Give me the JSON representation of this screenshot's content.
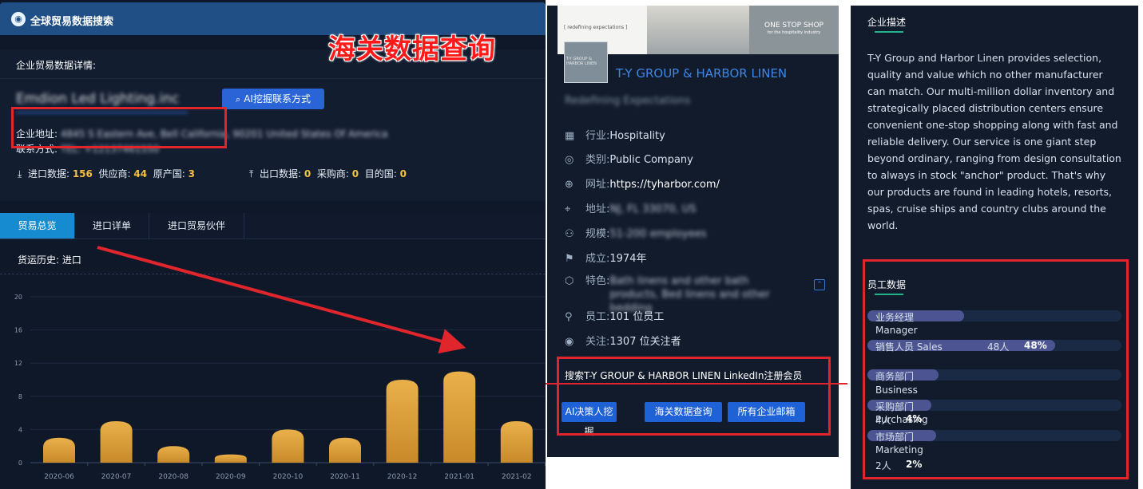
{
  "left": {
    "title": "全球贸易数据搜索",
    "section_header": "企业贸易数据详情:",
    "company_name": "Emdion Led Lighting.inc",
    "ai_button": "AI挖掘联系方式",
    "overlay_text": "海关数据查询",
    "address_label": "企业地址:",
    "address_value": "4845 S Eastern Ave, Bell California, 90201 United States Of America",
    "contact_label": "联系方式:",
    "contact_value": "TEL: +12137461550",
    "import_label": "进口数据:",
    "import_count": "156",
    "supplier_label": "供应商:",
    "supplier_count": "44",
    "origin_label": "原产国:",
    "origin_count": "3",
    "export_label": "出口数据:",
    "export_count": "0",
    "buyer_label": "采购商:",
    "buyer_count": "0",
    "dest_label": "目的国:",
    "dest_count": "0",
    "tabs": [
      "贸易总览",
      "进口详单",
      "进口贸易伙伴"
    ],
    "history_label": "货运历史: 进口"
  },
  "chart_data": {
    "type": "bar",
    "categories": [
      "2020-06",
      "2020-07",
      "2020-08",
      "2020-09",
      "2020-10",
      "2020-11",
      "2020-12",
      "2021-01",
      "2021-02"
    ],
    "values": [
      3,
      5,
      2,
      1,
      4,
      3,
      10,
      11,
      5
    ],
    "ylim": [
      0,
      20
    ],
    "yticks": [
      "0",
      "4",
      "8",
      "12",
      "16",
      "20"
    ],
    "grid": true,
    "bar_color": "#e9b04a"
  },
  "middle": {
    "banner_left": "[ redefining expectations ]",
    "banner_right": "ONE STOP SHOP",
    "banner_right_sub": "for the hospitality industry",
    "logo_text": "T-Y GROUP & HARBOR LINEN",
    "company": "T-Y GROUP & HARBOR LINEN",
    "tagline": "Redefining Expectations",
    "rows": [
      {
        "icon": "building-icon",
        "glyph": "▦",
        "label": "行业:",
        "value": "Hospitality"
      },
      {
        "icon": "target-icon",
        "glyph": "◎",
        "label": "类别:",
        "value": "Public Company"
      },
      {
        "icon": "globe-icon",
        "glyph": "⊕",
        "label": "网址:",
        "value": "https://tyharbor.com/"
      },
      {
        "icon": "location-icon",
        "glyph": "⌖",
        "label": "地址:",
        "value": "NJ, FL 33070, US"
      },
      {
        "icon": "people-icon",
        "glyph": "⚇",
        "label": "规模:",
        "value": "51-200 employees"
      },
      {
        "icon": "flag-icon",
        "glyph": "⚑",
        "label": "成立:",
        "value": "1974年"
      },
      {
        "icon": "cube-icon",
        "glyph": "⬡",
        "label": "特色:",
        "value": "Bath linens and other bath products, Bed linens and other bedding"
      },
      {
        "icon": "user-check-icon",
        "glyph": "⚲",
        "label": "员工:",
        "value": "101 位员工"
      },
      {
        "icon": "eye-icon",
        "glyph": "◉",
        "label": "关注:",
        "value": "1307 位关注者"
      }
    ],
    "search_text": "搜索T-Y GROUP & HARBOR LINEN LinkedIn注册会员",
    "buttons": [
      "AI决策人挖掘",
      "海关数据查询",
      "所有企业邮箱"
    ]
  },
  "right": {
    "desc_title": "企业描述",
    "description": "T-Y Group and Harbor Linen provides selection, quality and value which no other manufacturer can match. Our multi-million dollar inventory and strategically placed distribution centers ensure convenient one-stop shopping along with fast and reliable delivery. Our service is one giant step beyond ordinary, ranging from design consultation to always in stock \"anchor\" product. That's why our products are found in leading hotels, resorts, spas, cruise ships and country clubs around the world.",
    "emp_title": "员工数据",
    "employees": [
      {
        "dept": "业务经理",
        "role": "Manager",
        "fill": 0.38
      },
      {
        "dept": "销售人员 Sales",
        "count": "48人",
        "pct": "48%",
        "fill": 0.74
      },
      {
        "dept": "商务部门",
        "role": "Business",
        "fill": 0.28
      },
      {
        "dept": "采购部门",
        "role": "Purchasing",
        "count": "4人",
        "pct": "4%",
        "fill": 0.25
      },
      {
        "dept": "市场部门",
        "role": "Marketing",
        "count": "2人",
        "pct": "2%",
        "fill": 0.27
      }
    ]
  }
}
